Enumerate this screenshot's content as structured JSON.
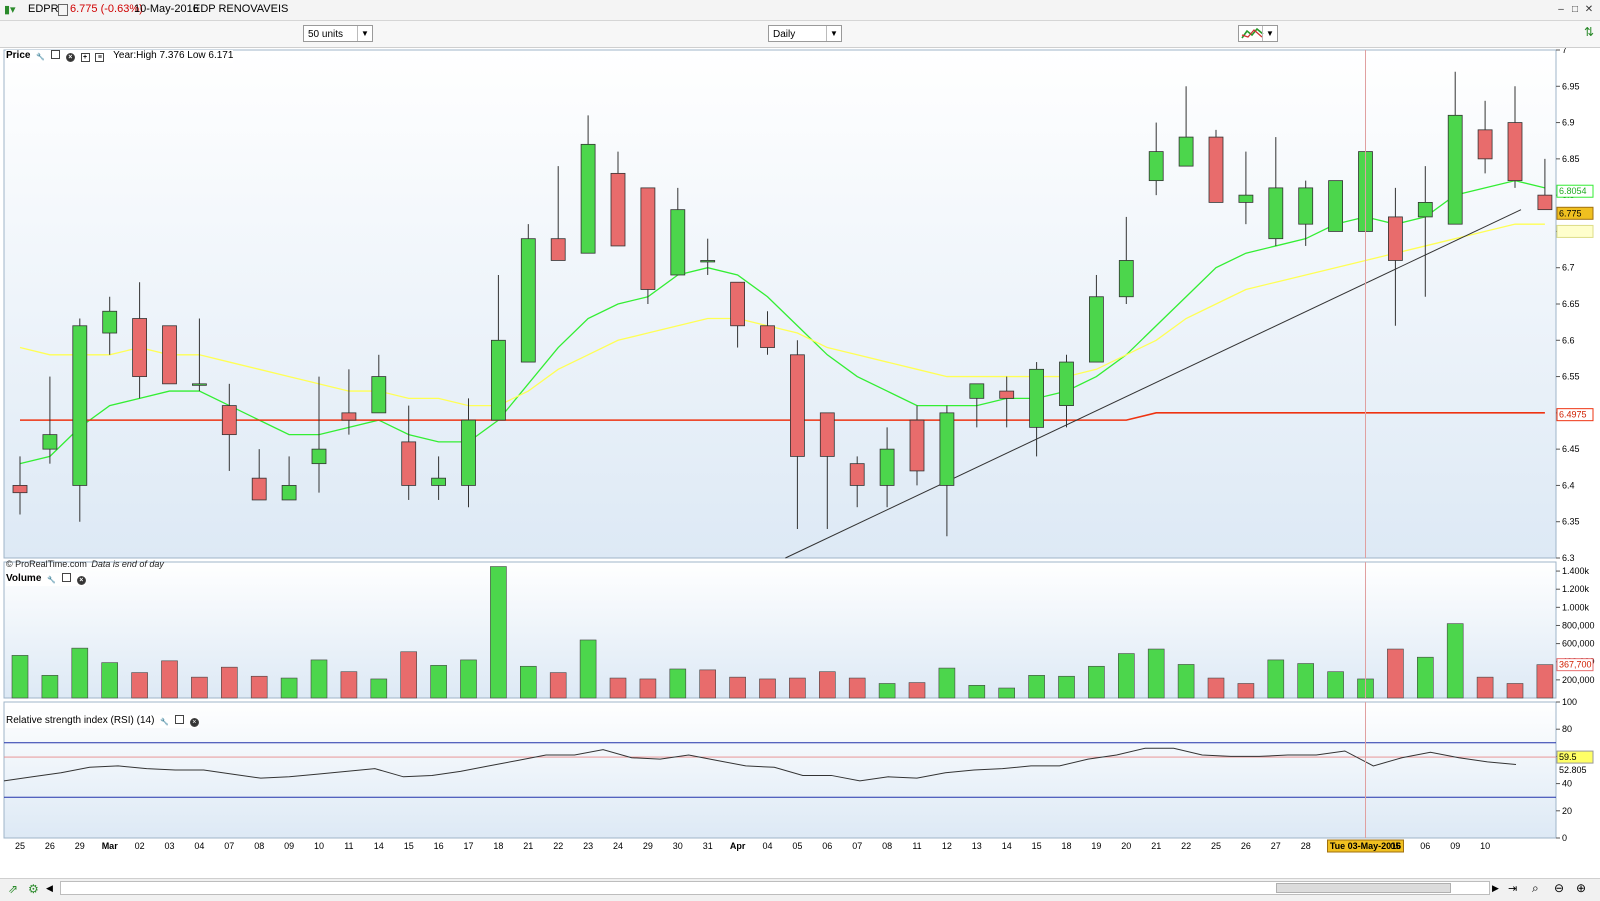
{
  "window": {
    "symbol": "EDPR",
    "change": "6.775 (-0.63%)",
    "date": "10-May-2016",
    "name": "EDP RENOVAVEIS"
  },
  "toolbar": {
    "units": "50 units",
    "period": "Daily"
  },
  "price_panel": {
    "label": "Price",
    "yearinfo": "Year:High 7.376 Low 6.171",
    "footer_source": "© ProRealTime.com",
    "footer_note": "Data is end of day"
  },
  "volume_panel": {
    "label": "Volume"
  },
  "rsi_panel": {
    "label": "Relative strength index (RSI) (14)"
  },
  "colors": {
    "up": "#4cd64c",
    "down": "#e86c6c",
    "ema_fast": "#33ee33",
    "ema_mid": "#ffff55",
    "ema_slow": "#ee3311",
    "rsi_line": "#333333",
    "band": "#2233aa",
    "midline": "#e88888",
    "cursor": "#e0a0a0",
    "badge_price": "#f0c020"
  },
  "badges": {
    "last_price": "6.775",
    "ema_fast": "6.8054",
    "ema_slow": "6.4975",
    "volume_last": "367,700",
    "rsi_mid": "59.5",
    "rsi_last": "52.805"
  },
  "x_axis": {
    "cursor_label": "Tue 03-May-2016",
    "labels": [
      "25",
      "26",
      "29",
      "Mar",
      "02",
      "03",
      "04",
      "07",
      "08",
      "09",
      "10",
      "11",
      "14",
      "15",
      "16",
      "17",
      "18",
      "21",
      "22",
      "23",
      "24",
      "29",
      "30",
      "31",
      "Apr",
      "04",
      "05",
      "06",
      "07",
      "08",
      "11",
      "12",
      "13",
      "14",
      "15",
      "18",
      "19",
      "20",
      "21",
      "22",
      "25",
      "26",
      "27",
      "28",
      "29",
      "Tue 03-May-2016",
      "05",
      "06",
      "09",
      "10"
    ]
  },
  "chart_data": [
    {
      "type": "candlestick",
      "title": "Price",
      "ylim": [
        6.3,
        7.0
      ],
      "yticks": [
        6.3,
        6.35,
        6.4,
        6.45,
        6.5,
        6.55,
        6.6,
        6.65,
        6.7,
        6.75,
        6.8,
        6.85,
        6.9,
        6.95,
        7.0
      ],
      "dates": [
        "Feb 25",
        "Feb 26",
        "Feb 29",
        "Mar 01",
        "Mar 02",
        "Mar 03",
        "Mar 04",
        "Mar 07",
        "Mar 08",
        "Mar 09",
        "Mar 10",
        "Mar 11",
        "Mar 14",
        "Mar 15",
        "Mar 16",
        "Mar 17",
        "Mar 18",
        "Mar 21",
        "Mar 22",
        "Mar 23",
        "Mar 24",
        "Mar 29",
        "Mar 30",
        "Mar 31",
        "Apr 01",
        "Apr 04",
        "Apr 05",
        "Apr 06",
        "Apr 07",
        "Apr 08",
        "Apr 11",
        "Apr 12",
        "Apr 13",
        "Apr 14",
        "Apr 15",
        "Apr 18",
        "Apr 19",
        "Apr 20",
        "Apr 21",
        "Apr 22",
        "Apr 25",
        "Apr 26",
        "Apr 27",
        "Apr 28",
        "Apr 29",
        "May 03",
        "May 04",
        "May 05",
        "May 06",
        "May 09",
        "May 10"
      ],
      "ohlc": [
        [
          6.4,
          6.44,
          6.36,
          6.39
        ],
        [
          6.45,
          6.55,
          6.43,
          6.47
        ],
        [
          6.4,
          6.63,
          6.35,
          6.62
        ],
        [
          6.61,
          6.66,
          6.58,
          6.64
        ],
        [
          6.63,
          6.68,
          6.52,
          6.55
        ],
        [
          6.62,
          6.62,
          6.54,
          6.54
        ],
        [
          6.54,
          6.63,
          6.53,
          6.54
        ],
        [
          6.51,
          6.54,
          6.42,
          6.47
        ],
        [
          6.41,
          6.45,
          6.39,
          6.38
        ],
        [
          6.38,
          6.44,
          6.38,
          6.4
        ],
        [
          6.43,
          6.55,
          6.39,
          6.45
        ],
        [
          6.5,
          6.56,
          6.47,
          6.49
        ],
        [
          6.5,
          6.58,
          6.5,
          6.55
        ],
        [
          6.46,
          6.51,
          6.38,
          6.4
        ],
        [
          6.4,
          6.44,
          6.38,
          6.41
        ],
        [
          6.4,
          6.52,
          6.37,
          6.49
        ],
        [
          6.49,
          6.69,
          6.49,
          6.6
        ],
        [
          6.57,
          6.76,
          6.57,
          6.74
        ],
        [
          6.74,
          6.84,
          6.72,
          6.71
        ],
        [
          6.72,
          6.91,
          6.72,
          6.87
        ],
        [
          6.83,
          6.86,
          6.73,
          6.73
        ],
        [
          6.81,
          6.81,
          6.65,
          6.67
        ],
        [
          6.69,
          6.81,
          6.69,
          6.78
        ],
        [
          6.71,
          6.74,
          6.69,
          6.71
        ],
        [
          6.68,
          6.68,
          6.59,
          6.62
        ],
        [
          6.62,
          6.64,
          6.58,
          6.59
        ],
        [
          6.58,
          6.6,
          6.34,
          6.44
        ],
        [
          6.5,
          6.5,
          6.34,
          6.44
        ],
        [
          6.43,
          6.44,
          6.37,
          6.4
        ],
        [
          6.4,
          6.48,
          6.37,
          6.45
        ],
        [
          6.49,
          6.51,
          6.4,
          6.42
        ],
        [
          6.4,
          6.51,
          6.33,
          6.5
        ],
        [
          6.52,
          6.54,
          6.48,
          6.54
        ],
        [
          6.53,
          6.55,
          6.48,
          6.52
        ],
        [
          6.48,
          6.57,
          6.44,
          6.56
        ],
        [
          6.51,
          6.58,
          6.48,
          6.57
        ],
        [
          6.57,
          6.69,
          6.57,
          6.66
        ],
        [
          6.66,
          6.77,
          6.65,
          6.71
        ],
        [
          6.82,
          6.9,
          6.8,
          6.86
        ],
        [
          6.84,
          6.95,
          6.84,
          6.88
        ],
        [
          6.88,
          6.89,
          6.79,
          6.79
        ],
        [
          6.79,
          6.86,
          6.76,
          6.8
        ],
        [
          6.74,
          6.88,
          6.73,
          6.81
        ],
        [
          6.76,
          6.82,
          6.73,
          6.81
        ],
        [
          6.75,
          6.82,
          6.75,
          6.82
        ],
        [
          6.75,
          6.92,
          6.75,
          6.86
        ],
        [
          6.77,
          6.81,
          6.62,
          6.71
        ],
        [
          6.77,
          6.84,
          6.66,
          6.79
        ],
        [
          6.76,
          6.97,
          6.76,
          6.91
        ],
        [
          6.89,
          6.93,
          6.83,
          6.85
        ],
        [
          6.9,
          6.95,
          6.81,
          6.82
        ],
        [
          6.8,
          6.85,
          6.78,
          6.78
        ]
      ],
      "series": [
        {
          "name": "6.8054",
          "values": [
            6.43,
            6.44,
            6.48,
            6.51,
            6.52,
            6.53,
            6.53,
            6.51,
            6.49,
            6.47,
            6.47,
            6.48,
            6.49,
            6.47,
            6.46,
            6.46,
            6.49,
            6.54,
            6.59,
            6.63,
            6.65,
            6.66,
            6.69,
            6.7,
            6.69,
            6.66,
            6.62,
            6.58,
            6.55,
            6.53,
            6.51,
            6.51,
            6.51,
            6.52,
            6.52,
            6.53,
            6.55,
            6.58,
            6.62,
            6.66,
            6.7,
            6.72,
            6.73,
            6.74,
            6.76,
            6.77,
            6.76,
            6.77,
            6.8,
            6.81,
            6.82,
            6.81
          ]
        },
        {
          "name": "",
          "values": [
            6.59,
            6.58,
            6.58,
            6.58,
            6.59,
            6.58,
            6.58,
            6.57,
            6.56,
            6.55,
            6.54,
            6.53,
            6.53,
            6.52,
            6.52,
            6.51,
            6.51,
            6.53,
            6.56,
            6.58,
            6.6,
            6.61,
            6.62,
            6.63,
            6.63,
            6.62,
            6.61,
            6.59,
            6.58,
            6.57,
            6.56,
            6.55,
            6.55,
            6.55,
            6.55,
            6.55,
            6.56,
            6.58,
            6.6,
            6.63,
            6.65,
            6.67,
            6.68,
            6.69,
            6.7,
            6.71,
            6.72,
            6.73,
            6.74,
            6.75,
            6.76,
            6.76
          ]
        },
        {
          "name": "6.4975",
          "values": [
            6.49,
            6.49,
            6.49,
            6.49,
            6.49,
            6.49,
            6.49,
            6.49,
            6.49,
            6.49,
            6.49,
            6.49,
            6.49,
            6.49,
            6.49,
            6.49,
            6.49,
            6.49,
            6.49,
            6.49,
            6.49,
            6.49,
            6.49,
            6.49,
            6.49,
            6.49,
            6.49,
            6.49,
            6.49,
            6.49,
            6.49,
            6.49,
            6.49,
            6.49,
            6.49,
            6.49,
            6.49,
            6.49,
            6.5,
            6.5,
            6.5,
            6.5,
            6.5,
            6.5,
            6.5,
            6.5,
            6.5,
            6.5,
            6.5,
            6.5,
            6.5,
            6.5
          ]
        }
      ],
      "trendline": {
        "from": {
          "date": "Apr 05",
          "price": 6.3
        },
        "to": {
          "date": "May 10",
          "price": 6.78
        }
      }
    },
    {
      "type": "bar",
      "title": "Volume",
      "ylim": [
        0,
        1500000
      ],
      "yticks": [
        "200,000",
        "400,000",
        "600,000",
        "800,000",
        "1.000k",
        "1.200k",
        "1.400k"
      ],
      "values": [
        470000,
        250000,
        550000,
        390000,
        280000,
        410000,
        230000,
        340000,
        240000,
        220000,
        420000,
        290000,
        210000,
        510000,
        360000,
        420000,
        1450000,
        350000,
        280000,
        640000,
        220000,
        210000,
        320000,
        310000,
        230000,
        210000,
        220000,
        290000,
        220000,
        160000,
        170000,
        330000,
        140000,
        110000,
        250000,
        240000,
        350000,
        490000,
        540000,
        370000,
        220000,
        160000,
        420000,
        380000,
        290000,
        210000,
        540000,
        450000,
        820000,
        230000,
        160000,
        367700
      ],
      "colors": [
        "up",
        "up",
        "up",
        "up",
        "down",
        "down",
        "down",
        "down",
        "down",
        "up",
        "up",
        "down",
        "up",
        "down",
        "up",
        "up",
        "up",
        "up",
        "down",
        "up",
        "down",
        "down",
        "up",
        "down",
        "down",
        "down",
        "down",
        "down",
        "down",
        "up",
        "down",
        "up",
        "up",
        "up",
        "up",
        "up",
        "up",
        "up",
        "up",
        "up",
        "down",
        "down",
        "up",
        "up",
        "up",
        "up",
        "down",
        "up",
        "up",
        "down",
        "down",
        "down"
      ]
    },
    {
      "type": "line",
      "title": "Relative strength index (RSI) (14)",
      "ylim": [
        0,
        100
      ],
      "yticks": [
        0,
        20,
        40,
        60,
        80,
        100
      ],
      "bands": [
        30,
        70
      ],
      "midline": 59.5,
      "values": [
        42,
        45,
        48,
        52,
        53,
        51,
        50,
        50,
        47,
        44,
        45,
        47,
        49,
        51,
        45,
        46,
        49,
        53,
        57,
        61,
        61,
        65,
        59,
        58,
        61,
        57,
        53,
        52,
        46,
        46,
        42,
        45,
        44,
        48,
        50,
        51,
        53,
        53,
        58,
        61,
        66,
        66,
        61,
        60,
        60,
        61,
        61,
        64,
        53,
        59,
        63,
        59,
        56,
        54
      ]
    }
  ]
}
